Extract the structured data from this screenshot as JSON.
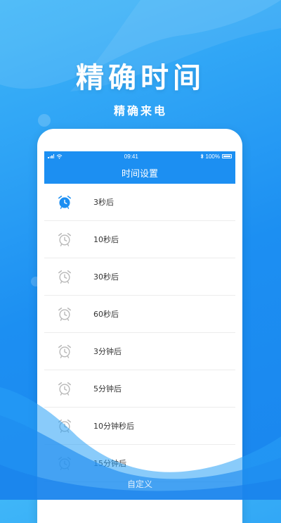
{
  "promo": {
    "headline": "精确时间",
    "subline": "精确来电"
  },
  "status_bar": {
    "time": "09:41",
    "battery": "100%"
  },
  "app_bar": {
    "title": "时间设置"
  },
  "options": [
    {
      "label": "3秒后",
      "active": true
    },
    {
      "label": "10秒后",
      "active": false
    },
    {
      "label": "30秒后",
      "active": false
    },
    {
      "label": "60秒后",
      "active": false
    },
    {
      "label": "3分钟后",
      "active": false
    },
    {
      "label": "5分钟后",
      "active": false
    },
    {
      "label": "10分钟秒后",
      "active": false
    },
    {
      "label": "15分钟后",
      "active": false
    }
  ],
  "footer": {
    "custom_label": "自定义"
  },
  "colors": {
    "primary": "#1c8ff2",
    "active_icon": "#1c8ff2",
    "inactive_icon": "#b8b8b8",
    "background_top": "#3fb6f8"
  },
  "icons": {
    "option_icon": "alarm-clock-icon",
    "wifi": "wifi-icon",
    "bluetooth": "bluetooth-icon",
    "battery": "battery-icon",
    "signal": "signal-icon"
  }
}
